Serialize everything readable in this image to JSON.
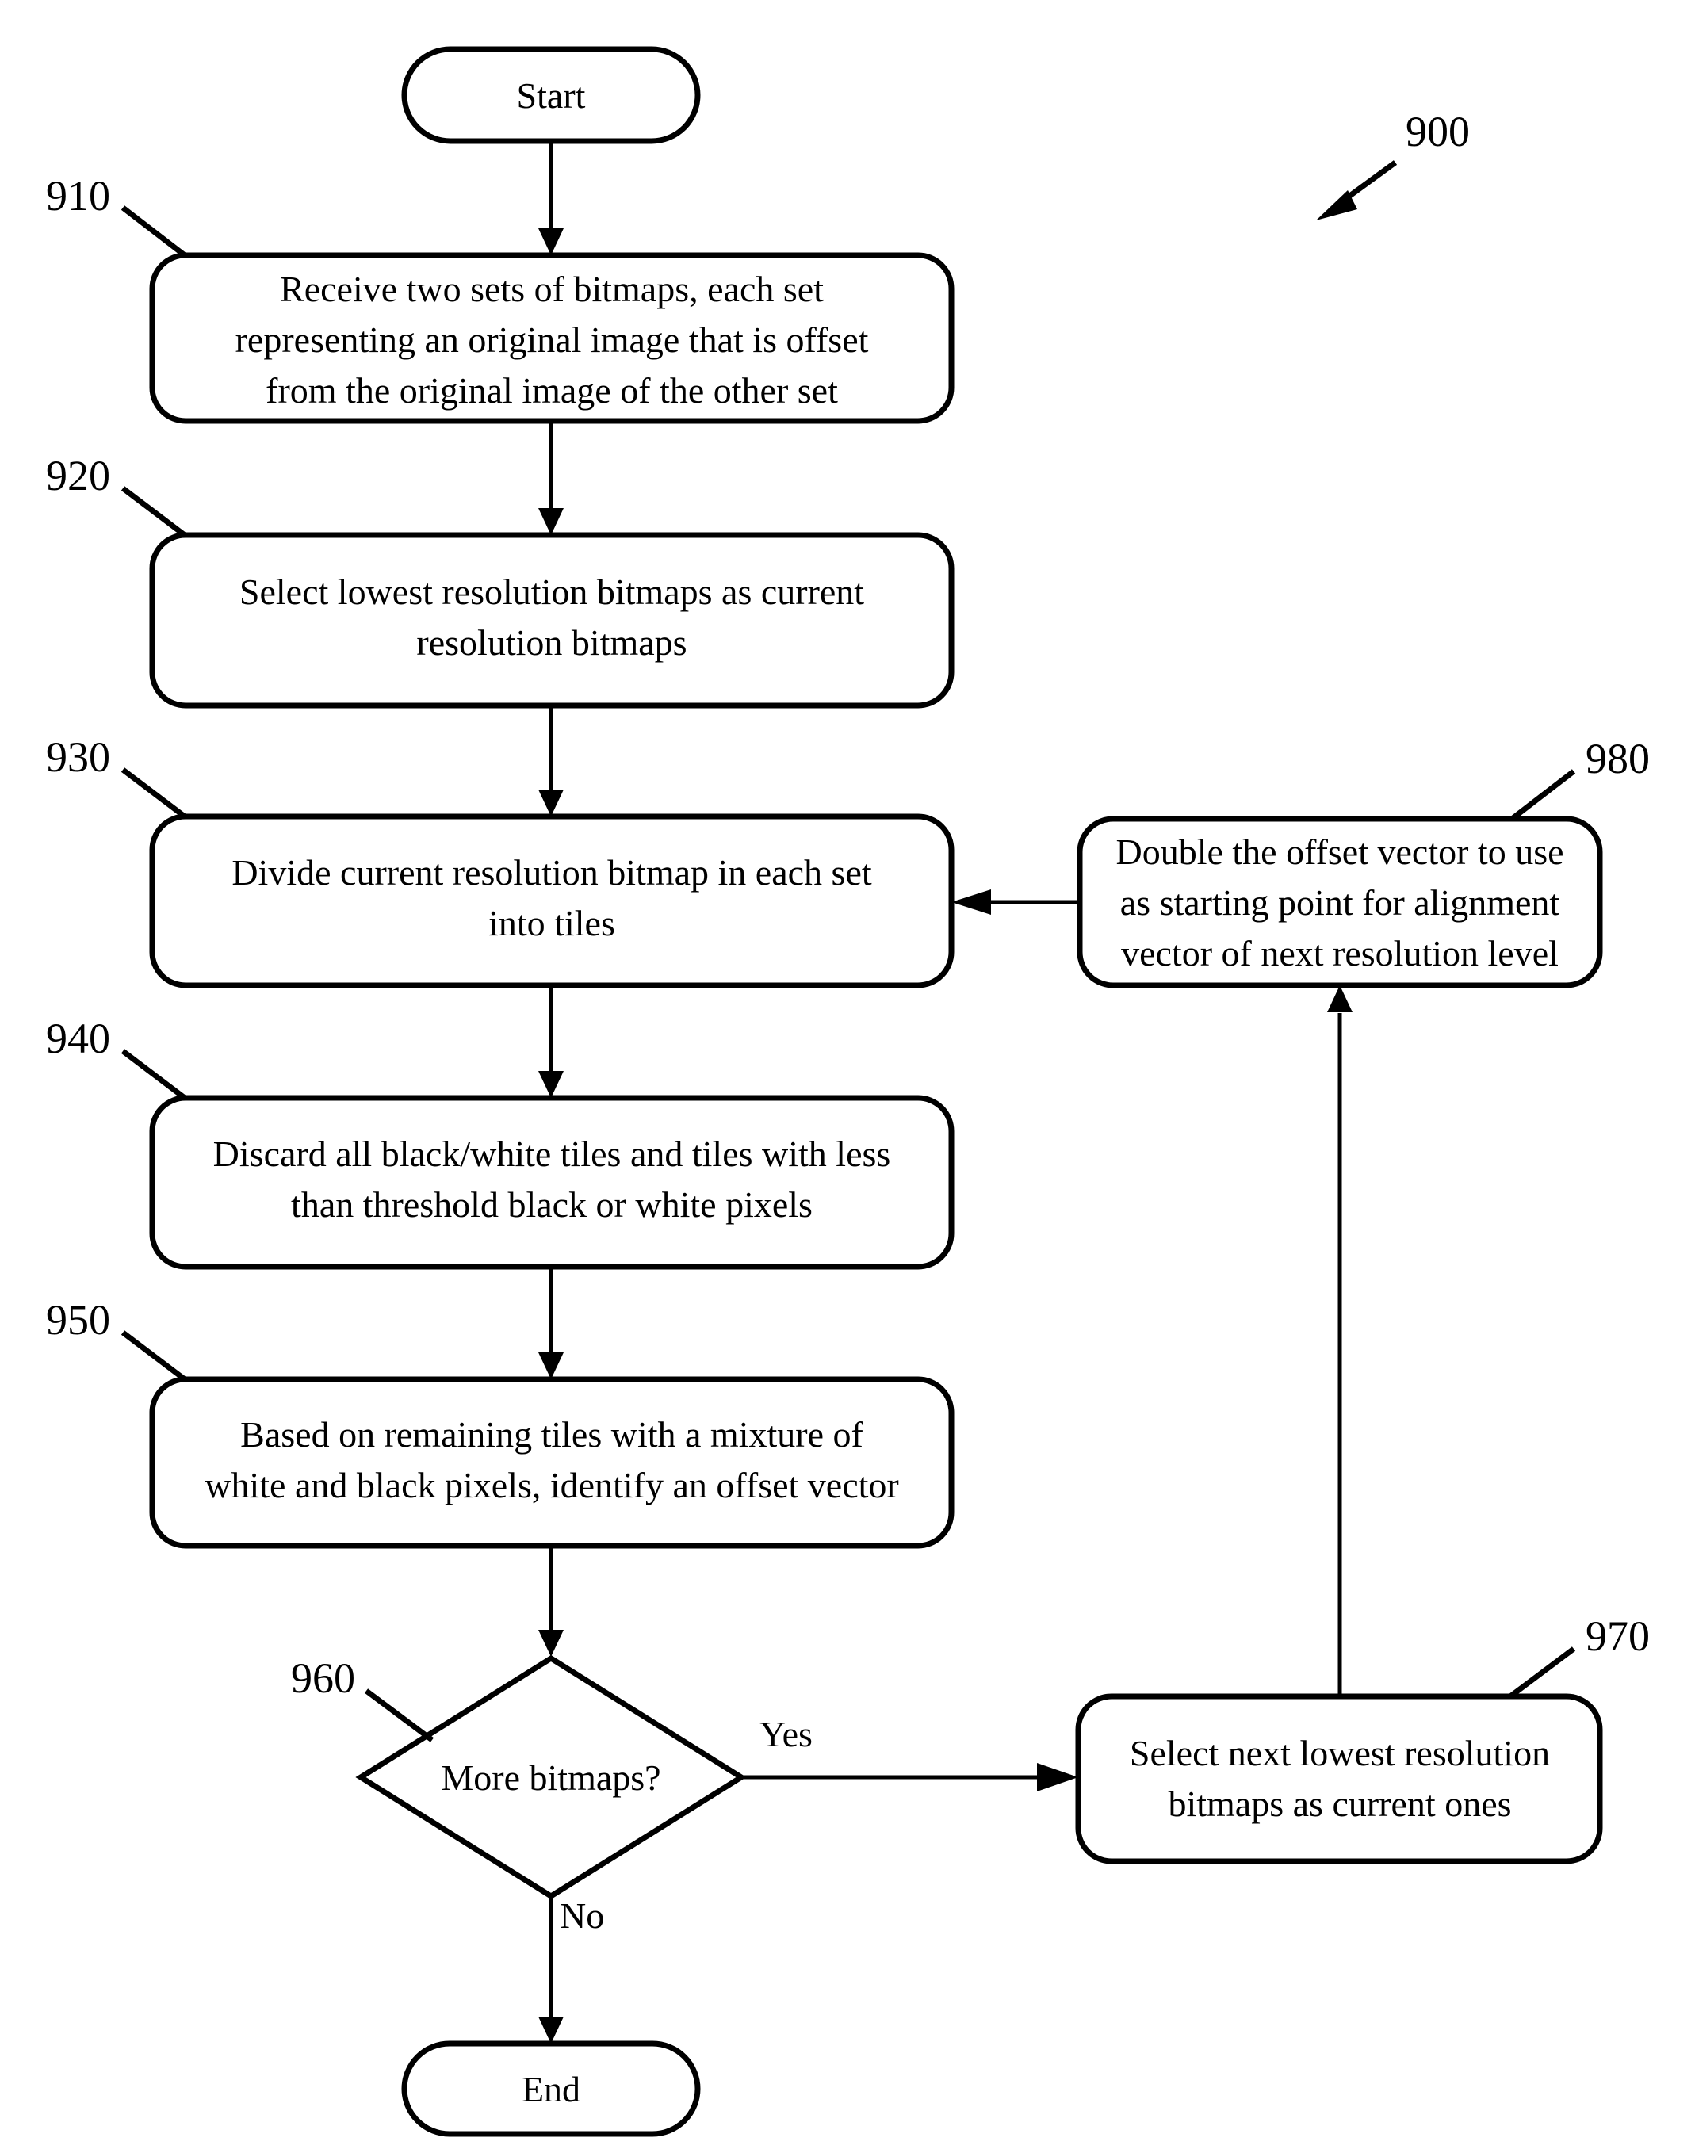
{
  "figure": {
    "number": "900",
    "type": "patent-flowchart",
    "background_color": "#ffffff",
    "line_color": "#000000"
  },
  "terminals": {
    "start": {
      "label": "Start"
    },
    "end": {
      "label": "End"
    }
  },
  "steps": [
    {
      "ref": "910",
      "lines": [
        "Receive two sets of bitmaps, each set",
        "representing an original image that is offset",
        "from the original image of the other set"
      ]
    },
    {
      "ref": "920",
      "lines": [
        "Select lowest resolution bitmaps as current",
        "resolution bitmaps"
      ]
    },
    {
      "ref": "930",
      "lines": [
        "Divide current resolution bitmap in each set",
        "into tiles"
      ]
    },
    {
      "ref": "940",
      "lines": [
        "Discard all black/white tiles and tiles with less",
        "than threshold black or white pixels"
      ]
    },
    {
      "ref": "950",
      "lines": [
        "Based on remaining tiles with a mixture of",
        "white and black pixels, identify an offset vector"
      ]
    },
    {
      "ref": "970",
      "lines": [
        "Select next lowest resolution",
        "bitmaps as current ones"
      ]
    },
    {
      "ref": "980",
      "lines": [
        "Double the offset vector to use",
        "as starting point for alignment",
        "vector of next resolution level"
      ]
    }
  ],
  "decision": {
    "ref": "960",
    "label": "More bitmaps?",
    "branch_yes": "Yes",
    "branch_no": "No"
  }
}
